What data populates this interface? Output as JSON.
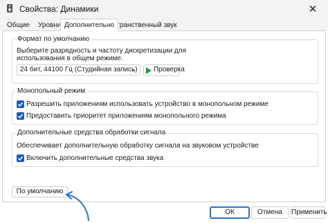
{
  "window": {
    "title": "Свойства: Динамики",
    "close_glyph": "✕"
  },
  "tabs": [
    {
      "label": "Общие",
      "active": false
    },
    {
      "label": "Уровни",
      "active": false
    },
    {
      "label": "Дополнительно",
      "active": true
    },
    {
      "label": "Пространственный звук",
      "active": false
    }
  ],
  "default_format": {
    "legend": "Формат по умолчанию",
    "description_line1": "Выберите разрядность и частоту дискретизации для",
    "description_line2": "использования в общем режиме.",
    "selected_format": "24 бит, 44100 Гц (Студийная запись)",
    "test_button": "Проверка"
  },
  "exclusive_mode": {
    "legend": "Монопольный режим",
    "options": [
      {
        "label": "Разрешить приложениям использовать устройство в монопольном режиме",
        "checked": true
      },
      {
        "label": "Предоставить приоритет приложениям монопольного режима",
        "checked": true
      }
    ]
  },
  "signal_enhancements": {
    "legend": "Дополнительные средства обработки сигнала",
    "description": "Обеспечивает дополнительную обработку сигнала на звуковом устройстве",
    "option": {
      "label": "Включить дополнительные средства звука",
      "checked": true
    }
  },
  "buttons": {
    "restore_defaults": "По умолчанию",
    "ok": "ОК",
    "cancel": "Отмена",
    "apply": "Применить"
  },
  "colors": {
    "accent": "#1c5fb0",
    "annotation_arrow": "#2a7fc9",
    "play_icon": "#1f9d3a"
  },
  "icons": {
    "window": "speaker-icon",
    "dropdown": "chevron-down-icon",
    "test": "play-icon",
    "checkbox": "checkmark-icon",
    "annotation": "curved-arrow-annotation"
  }
}
